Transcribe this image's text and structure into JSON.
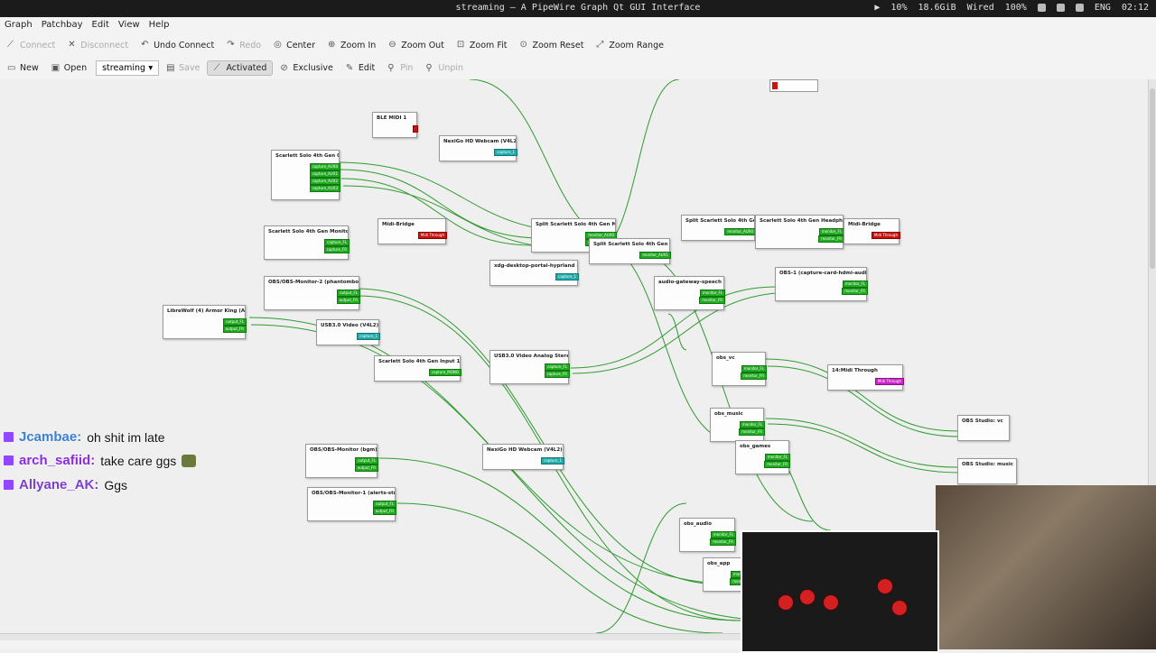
{
  "window": {
    "title": "streaming — A PipeWire Graph Qt GUI Interface"
  },
  "panel": {
    "cpu": "10%",
    "mem": "18.6GiB",
    "net": "Wired",
    "vol": "100%",
    "lang": "ENG",
    "clock": "02:12"
  },
  "menu": [
    "Graph",
    "Patchbay",
    "Edit",
    "View",
    "Help"
  ],
  "toolbar": {
    "connect": "Connect",
    "disconnect": "Disconnect",
    "undo": "Undo Connect",
    "redo": "Redo",
    "center": "Center",
    "zoom_in": "Zoom In",
    "zoom_out": "Zoom Out",
    "zoom_fit": "Zoom Fit",
    "zoom_reset": "Zoom Reset",
    "zoom_range": "Zoom Range"
  },
  "toolbar2": {
    "new": "New",
    "open": "Open",
    "patchbay": "streaming",
    "save": "Save",
    "activated": "Activated",
    "exclusive": "Exclusive",
    "edit": "Edit",
    "pin": "Pin",
    "unpin": "Unpin"
  },
  "nodes": [
    {
      "name": "BLE MIDI 1",
      "ports": [
        {
          "t": "midi",
          "l": ""
        }
      ]
    },
    {
      "name": "NexiGo HD Webcam (V4L2)",
      "ports": [
        {
          "t": "video",
          "l": "capture_1"
        }
      ]
    },
    {
      "name": "Scarlett Solo 4th Gen 0",
      "ports": [
        {
          "t": "audio",
          "l": "capture_AUX0"
        },
        {
          "t": "audio",
          "l": "capture_AUX1"
        },
        {
          "t": "audio",
          "l": "capture_AUX2"
        },
        {
          "t": "audio",
          "l": "capture_AUX3"
        }
      ]
    },
    {
      "name": "Scarlett Solo 4th Gen Monitor...",
      "ports": [
        {
          "t": "audio",
          "l": "capture_FL"
        },
        {
          "t": "audio",
          "l": "capture_FR"
        }
      ]
    },
    {
      "name": "Midi-Bridge",
      "ports": [
        {
          "t": "midi",
          "l": "Midi Through"
        }
      ]
    },
    {
      "name": "Split Scarlett Solo 4th Gen M...",
      "ports": [
        {
          "t": "audio",
          "l": "monitor_AUX0"
        },
        {
          "t": "audio",
          "l": "monitor_AUX1"
        }
      ]
    },
    {
      "name": "Split Scarlett Solo 4th Gen I...",
      "ports": [
        {
          "t": "audio",
          "l": "monitor_AUX0"
        }
      ]
    },
    {
      "name": "Scarlett Solo 4th Gen Headpho...",
      "ports": [
        {
          "t": "audio",
          "l": "monitor_FL"
        },
        {
          "t": "audio",
          "l": "monitor_FR"
        }
      ]
    },
    {
      "name": "Midi-Bridge",
      "ports": [
        {
          "t": "midi",
          "l": "Midi Through"
        }
      ]
    },
    {
      "name": "Split Scarlett Solo 4th Gen I...",
      "ports": [
        {
          "t": "audio",
          "l": "monitor_AUX1"
        }
      ]
    },
    {
      "name": "xdg-desktop-portal-hyprland (...",
      "ports": [
        {
          "t": "video",
          "l": "capture_1"
        }
      ]
    },
    {
      "name": "OBS/OBS-Monitor-2 (phantombot...",
      "ports": [
        {
          "t": "audio",
          "l": "output_FL"
        },
        {
          "t": "audio",
          "l": "output_FR"
        }
      ]
    },
    {
      "name": "LibreWolf (4) Armor King (Ac...",
      "ports": [
        {
          "t": "audio",
          "l": "output_FL"
        },
        {
          "t": "audio",
          "l": "output_FR"
        }
      ]
    },
    {
      "name": "USB3.0 Video (V4L2)",
      "ports": [
        {
          "t": "video",
          "l": "capture_1"
        }
      ]
    },
    {
      "name": "audio-gateway-speech",
      "ports": [
        {
          "t": "audio",
          "l": "monitor_FL"
        },
        {
          "t": "audio",
          "l": "monitor_FR"
        }
      ]
    },
    {
      "name": "OBS-1 (capture-card-hdmi-audio)",
      "ports": [
        {
          "t": "audio",
          "l": "monitor_FL"
        },
        {
          "t": "audio",
          "l": "monitor_FR"
        }
      ]
    },
    {
      "name": "Scarlett Solo 4th Gen Input 1...",
      "ports": [
        {
          "t": "audio",
          "l": "capture_MONO"
        }
      ]
    },
    {
      "name": "USB3.0 Video Analog Stereo",
      "ports": [
        {
          "t": "audio",
          "l": "capture_FL"
        },
        {
          "t": "audio",
          "l": "capture_FR"
        }
      ]
    },
    {
      "name": "obs_vc",
      "ports": [
        {
          "t": "audio",
          "l": "monitor_FL"
        },
        {
          "t": "audio",
          "l": "monitor_FR"
        }
      ]
    },
    {
      "name": "14:Midi Through",
      "ports": [
        {
          "t": "ump",
          "l": "Midi Through"
        }
      ]
    },
    {
      "name": "obs_music",
      "ports": [
        {
          "t": "audio",
          "l": "monitor_FL"
        },
        {
          "t": "audio",
          "l": "monitor_FR"
        }
      ]
    },
    {
      "name": "OBS Studio: vc",
      "ports": []
    },
    {
      "name": "obs_games",
      "ports": [
        {
          "t": "audio",
          "l": "monitor_FL"
        },
        {
          "t": "audio",
          "l": "monitor_FR"
        }
      ]
    },
    {
      "name": "OBS Studio: music",
      "ports": []
    },
    {
      "name": "OBS/OBS-Monitor (bgm)",
      "ports": [
        {
          "t": "audio",
          "l": "output_FL"
        },
        {
          "t": "audio",
          "l": "output_FR"
        }
      ]
    },
    {
      "name": "NexiGo HD Webcam (V4L2)-1",
      "ports": [
        {
          "t": "video",
          "l": "capture_1"
        }
      ]
    },
    {
      "name": "OBS/OBS-Monitor-1 (alerts-str...",
      "ports": [
        {
          "t": "audio",
          "l": "output_FL"
        },
        {
          "t": "audio",
          "l": "output_FR"
        }
      ]
    },
    {
      "name": "obs_audio",
      "ports": [
        {
          "t": "audio",
          "l": "monitor_FL"
        },
        {
          "t": "audio",
          "l": "monitor_FR"
        }
      ]
    },
    {
      "name": "obs_app",
      "ports": [
        {
          "t": "audio",
          "l": "monitor_FL"
        },
        {
          "t": "audio",
          "l": "monitor_FR"
        }
      ]
    }
  ],
  "chat": [
    {
      "user": "Jcambae:",
      "msg": "oh shit im late",
      "color": "#3a7fd5"
    },
    {
      "user": "arch_safiid:",
      "msg": "take care ggs",
      "color": "#8a2be2"
    },
    {
      "user": "Allyane_AK:",
      "msg": "Ggs",
      "color": "#7b3fd0"
    }
  ]
}
